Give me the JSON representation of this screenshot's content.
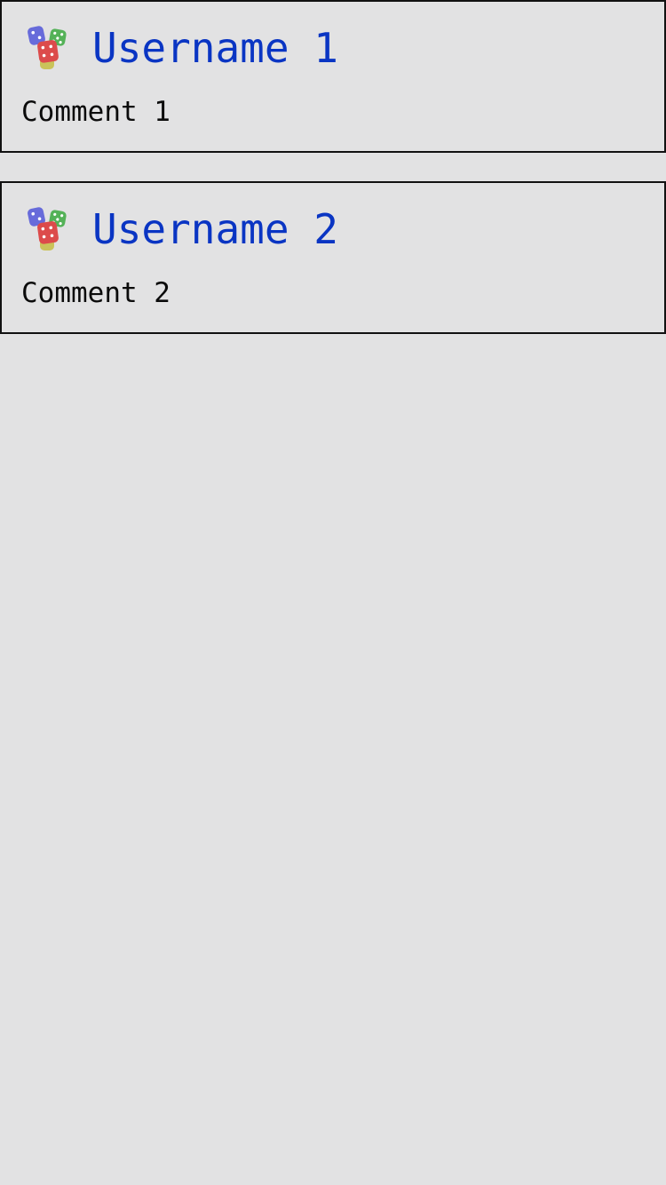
{
  "comments": [
    {
      "username": "Username 1",
      "text": "Comment 1",
      "avatar_icon": "dice-icon"
    },
    {
      "username": "Username 2",
      "text": "Comment 2",
      "avatar_icon": "dice-icon"
    }
  ],
  "colors": {
    "background": "#e2e2e3",
    "username": "#0a35c3",
    "comment": "#0b0b0b",
    "border": "#111111"
  }
}
